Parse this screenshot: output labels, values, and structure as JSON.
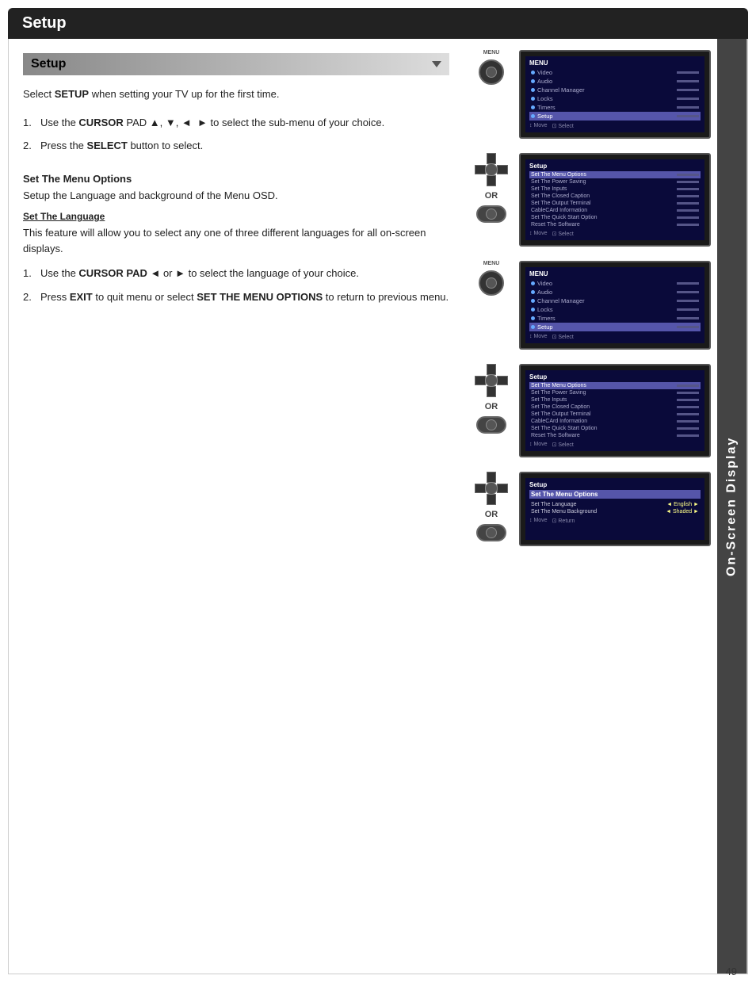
{
  "header": {
    "title": "Setup"
  },
  "side_tab": {
    "label": "On-Screen Display"
  },
  "section1": {
    "title": "Setup",
    "intro": "Select SETUP when setting your TV up for the first time.",
    "intro_bold": "SETUP",
    "steps": [
      {
        "num": "1.",
        "text_before": "Use the ",
        "bold": "CURSOR",
        "text_after": " PAD ▲, ▼, ◄  ► to select the sub-menu of your choice."
      },
      {
        "num": "2.",
        "text_before": "Press the ",
        "bold": "SELECT",
        "text_after": " button to select."
      }
    ]
  },
  "section2": {
    "title": "Set The Menu Options",
    "desc": "Setup the Language and background of the Menu OSD.",
    "sub_title": "Set The Language",
    "sub_desc": "This feature will allow you to select any one of three different languages for all on-screen displays.",
    "steps": [
      {
        "num": "1.",
        "text_before": "Use the ",
        "bold": "CURSOR PAD",
        "text_after": " ◄ or ► to select the language of your choice."
      },
      {
        "num": "2.",
        "text_before": "Press ",
        "bold": "EXIT",
        "text_after": " to quit menu or select ",
        "bold2": "SET THE MENU OPTIONS",
        "text_after2": " to return to previous menu."
      }
    ]
  },
  "diagrams": {
    "screen1_menu_items": [
      "Video",
      "Audio",
      "Channel Manager",
      "Locks",
      "Timers",
      "Setup"
    ],
    "screen2_setup_items": [
      "Set The Menu Options",
      "Set The Power Saving",
      "Set The Inputs",
      "Set The Closed Caption",
      "Set The Output Terminal",
      "CableCard Information",
      "Set The Quick Start Option",
      "Reset The Software"
    ],
    "screen3_lang_items": [
      {
        "label": "Set The Language",
        "value": "◄  English  ►"
      },
      {
        "label": "Set The Menu Background",
        "value": "◄  Shaded  ►"
      }
    ]
  },
  "page_number": "49"
}
